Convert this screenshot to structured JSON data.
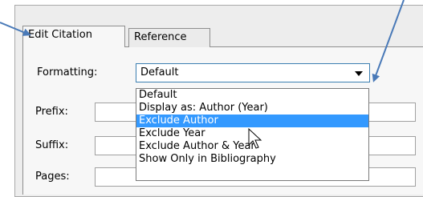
{
  "tabs": {
    "edit_citation": "Edit Citation",
    "reference": "Reference"
  },
  "form": {
    "formatting_label": "Formatting:",
    "formatting_value": "Default",
    "prefix_label": "Prefix:",
    "suffix_label": "Suffix:",
    "pages_label": "Pages:"
  },
  "dropdown": {
    "options": [
      "Default",
      "Display as: Author (Year)",
      "Exclude Author",
      "Exclude Year",
      "Exclude Author & Year",
      "Show Only in Bibliography"
    ],
    "selected": "Exclude Author"
  },
  "colors": {
    "annotation_arrow": "#4a7ab8",
    "highlight": "#3399ff"
  },
  "icons": [
    "annotation-arrow-icon",
    "mouse-cursor-icon",
    "chevron-down-icon"
  ]
}
